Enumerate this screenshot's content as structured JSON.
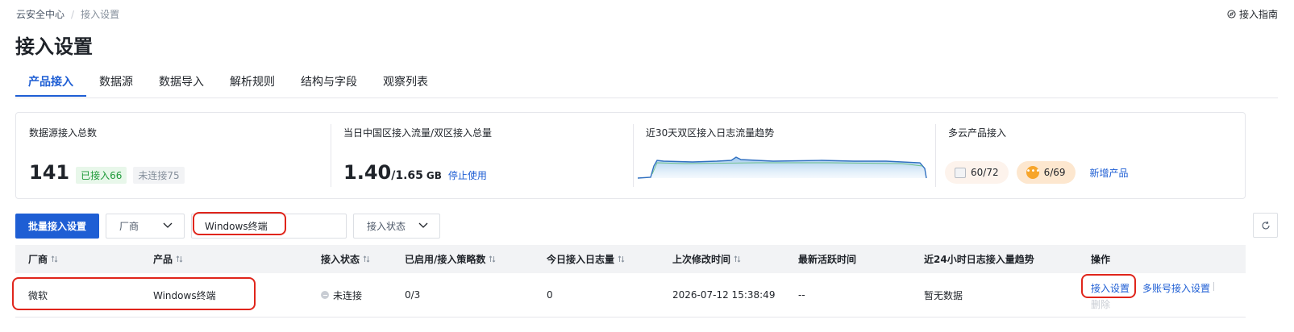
{
  "breadcrumb": {
    "root": "云安全中心",
    "separator": "/",
    "current": "接入设置"
  },
  "guide_link": "接入指南",
  "page_title": "接入设置",
  "tabs": [
    "产品接入",
    "数据源",
    "数据导入",
    "解析规则",
    "结构与字段",
    "观察列表"
  ],
  "active_tab": "产品接入",
  "stats": {
    "source_total": {
      "label": "数据源接入总数",
      "value": "141",
      "connected": "已接入66",
      "not_connected": "未连接75"
    },
    "flow": {
      "label": "当日中国区接入流量/双区接入总量",
      "value": "1.40",
      "total": "/1.65",
      "unit": "GB",
      "stop_link": "停止使用"
    },
    "trend": {
      "label": "近30天双区接入日志流量趋势"
    },
    "multi_cloud": {
      "label": "多云产品接入",
      "cloud_a": "60/72",
      "cloud_b": "6/69",
      "add_link": "新增产品"
    }
  },
  "toolbar": {
    "batch_button": "批量接入设置",
    "vendor_select": "厂商",
    "search_value": "Windows终端",
    "status_select": "接入状态"
  },
  "table": {
    "headers": [
      "厂商",
      "产品",
      "接入状态",
      "已启用/接入策略数",
      "今日接入日志量",
      "上次修改时间",
      "最新活跃时间",
      "近24小时日志接入量趋势",
      "操作"
    ],
    "rows": [
      {
        "vendor": "微软",
        "product": "Windows终端",
        "status": "未连接",
        "policies": "0/3",
        "today_logs": "0",
        "modified": "2026-07-12 15:38:49",
        "active": "--",
        "trend": "暂无数据",
        "ops": [
          "接入设置",
          "多账号接入设置",
          "删除"
        ]
      }
    ]
  },
  "colors": {
    "accent": "#1e5ed4",
    "annotation": "#e0251b",
    "connected_green": "#1f9a3a",
    "cloud_orange": "#f7a52b"
  },
  "icons": [
    "compass-icon",
    "chevron-down-icon",
    "refresh-icon",
    "sort-icon",
    "broken-image-icon",
    "ellipsis-icon"
  ]
}
